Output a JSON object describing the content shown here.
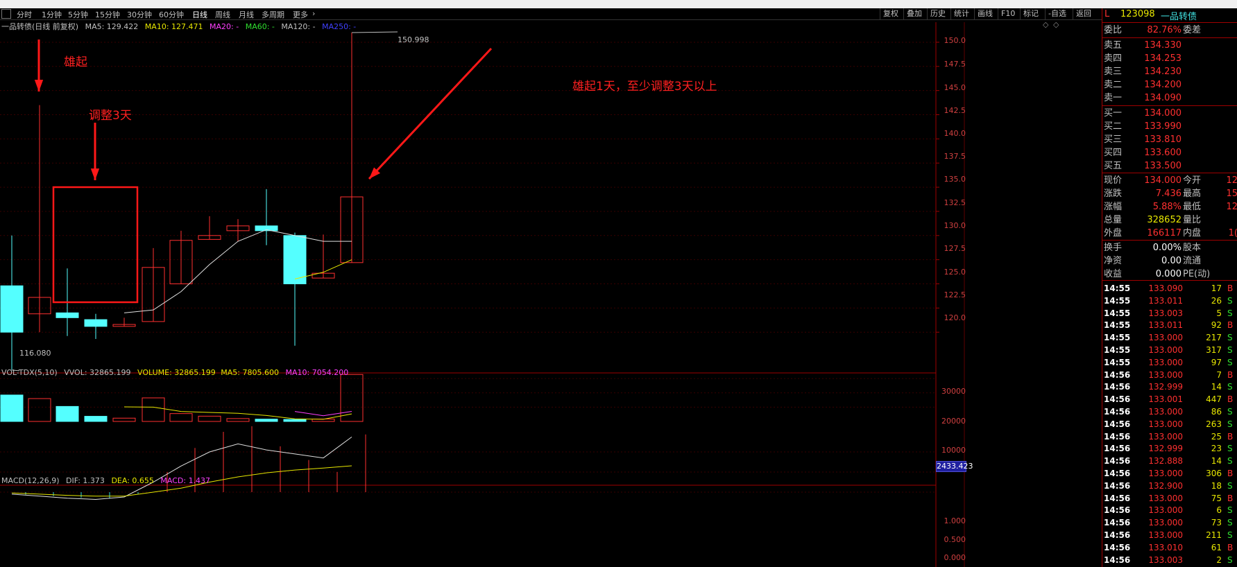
{
  "toolbar": {
    "periods": [
      "分时",
      "1分钟",
      "5分钟",
      "15分钟",
      "30分钟",
      "60分钟",
      "日线",
      "周线",
      "月线",
      "多周期",
      "更多"
    ],
    "active_period": "日线",
    "right_buttons": [
      "复权",
      "叠加",
      "历史",
      "统计",
      "画线",
      "F10",
      "标记",
      "-自选",
      "返回"
    ]
  },
  "chart_info": {
    "title": "一品转债(日线 前复权)",
    "ma5": "MA5: 129.422",
    "ma10": "MA10: 127.471",
    "ma20": "MA20: -",
    "ma60": "MA60: -",
    "ma120": "MA120: -",
    "ma250": "MA250: -",
    "high_label": "150.998",
    "low_label": "116.080"
  },
  "volume_info": {
    "label": "VOL-TDX(5,10)",
    "vvol": "VVOL: 32865.199",
    "volume": "VOLUME: 32865.199",
    "ma5": "MA5: 7805.600",
    "ma10": "MA10: 7054.200",
    "current_box": "2433.423"
  },
  "macd_info": {
    "label": "MACD(12,26,9)",
    "dif": "DIF: 1.373",
    "dea": "DEA: 0.655",
    "macd": "MACD: 1.437"
  },
  "price_axis": [
    "150.0",
    "147.5",
    "145.0",
    "142.5",
    "140.0",
    "137.5",
    "135.0",
    "132.5",
    "130.0",
    "127.5",
    "125.0",
    "122.5",
    "120.0"
  ],
  "vol_axis": [
    "30000",
    "20000",
    "10000"
  ],
  "macd_axis": [
    "1.000",
    "0.500",
    "0.000"
  ],
  "annotations": {
    "a1": "雄起",
    "a2": "调整3天",
    "a3": "雄起1天，至少调整3天以上"
  },
  "quote": {
    "flag": "L",
    "code": "123098",
    "name": "一品转债",
    "weibi_label": "委比",
    "weibi_value": "82.76%",
    "weicha_label": "委差",
    "sell": [
      {
        "label": "卖五",
        "price": "134.330"
      },
      {
        "label": "卖四",
        "price": "134.253"
      },
      {
        "label": "卖三",
        "price": "134.230"
      },
      {
        "label": "卖二",
        "price": "134.200"
      },
      {
        "label": "卖一",
        "price": "134.090"
      }
    ],
    "buy": [
      {
        "label": "买一",
        "price": "134.000"
      },
      {
        "label": "买二",
        "price": "133.990"
      },
      {
        "label": "买三",
        "price": "133.810"
      },
      {
        "label": "买四",
        "price": "133.600"
      },
      {
        "label": "买五",
        "price": "133.500"
      }
    ],
    "stats": [
      {
        "l1": "现价",
        "v1": "134.000",
        "c1": "#ff3030",
        "l2": "今开",
        "v2": "12"
      },
      {
        "l1": "涨跌",
        "v1": "7.436",
        "c1": "#ff3030",
        "l2": "最高",
        "v2": "15"
      },
      {
        "l1": "涨幅",
        "v1": "5.88%",
        "c1": "#ff3030",
        "l2": "最低",
        "v2": "12"
      },
      {
        "l1": "总量",
        "v1": "328652",
        "c1": "#e8e800",
        "l2": "量比",
        "v2": ""
      },
      {
        "l1": "外盘",
        "v1": "166117",
        "c1": "#ff3030",
        "l2": "内盘",
        "v2": "1("
      }
    ],
    "stats2": [
      {
        "l1": "换手",
        "v1": "0.00%",
        "l2": "股本"
      },
      {
        "l1": "净资",
        "v1": "0.00",
        "l2": "流通"
      },
      {
        "l1": "收益",
        "v1": "0.000",
        "l2": "PE(动)"
      }
    ],
    "ticks": [
      {
        "t": "14:55",
        "p": "133.090",
        "v": "17",
        "s": "B"
      },
      {
        "t": "14:55",
        "p": "133.011",
        "v": "26",
        "s": "S"
      },
      {
        "t": "14:55",
        "p": "133.003",
        "v": "5",
        "s": "S"
      },
      {
        "t": "14:55",
        "p": "133.011",
        "v": "92",
        "s": "B"
      },
      {
        "t": "14:55",
        "p": "133.000",
        "v": "217",
        "s": "S"
      },
      {
        "t": "14:55",
        "p": "133.000",
        "v": "317",
        "s": "S"
      },
      {
        "t": "14:55",
        "p": "133.000",
        "v": "97",
        "s": "S"
      },
      {
        "t": "14:56",
        "p": "133.000",
        "v": "7",
        "s": "B"
      },
      {
        "t": "14:56",
        "p": "132.999",
        "v": "14",
        "s": "S"
      },
      {
        "t": "14:56",
        "p": "133.001",
        "v": "447",
        "s": "B"
      },
      {
        "t": "14:56",
        "p": "133.000",
        "v": "86",
        "s": "S"
      },
      {
        "t": "14:56",
        "p": "133.000",
        "v": "263",
        "s": "S"
      },
      {
        "t": "14:56",
        "p": "133.000",
        "v": "25",
        "s": "B"
      },
      {
        "t": "14:56",
        "p": "132.999",
        "v": "23",
        "s": "S"
      },
      {
        "t": "14:56",
        "p": "132.888",
        "v": "14",
        "s": "S"
      },
      {
        "t": "14:56",
        "p": "133.000",
        "v": "306",
        "s": "B"
      },
      {
        "t": "14:56",
        "p": "132.900",
        "v": "18",
        "s": "S"
      },
      {
        "t": "14:56",
        "p": "133.000",
        "v": "75",
        "s": "B"
      },
      {
        "t": "14:56",
        "p": "133.000",
        "v": "6",
        "s": "S"
      },
      {
        "t": "14:56",
        "p": "133.000",
        "v": "73",
        "s": "S"
      },
      {
        "t": "14:56",
        "p": "133.000",
        "v": "211",
        "s": "S"
      },
      {
        "t": "14:56",
        "p": "133.010",
        "v": "61",
        "s": "B"
      },
      {
        "t": "14:56",
        "p": "133.003",
        "v": "2",
        "s": "S"
      }
    ]
  },
  "chart_data": {
    "type": "candlestick",
    "candles": [
      {
        "o": 124.8,
        "c": 120.0,
        "h": 130.0,
        "l": 116.08
      },
      {
        "o": 121.9,
        "c": 123.6,
        "h": 143.5,
        "l": 120.0
      },
      {
        "o": 122.0,
        "c": 121.5,
        "h": 126.6,
        "l": 119.6
      },
      {
        "o": 121.3,
        "c": 120.6,
        "h": 121.9,
        "l": 119.3
      },
      {
        "o": 120.6,
        "c": 120.8,
        "h": 121.5,
        "l": 120.6
      },
      {
        "o": 121.1,
        "c": 126.7,
        "h": 128.7,
        "l": 121.1
      },
      {
        "o": 125.0,
        "c": 129.5,
        "h": 130.5,
        "l": 125.0
      },
      {
        "o": 129.6,
        "c": 130.0,
        "h": 132.0,
        "l": 129.6
      },
      {
        "o": 130.5,
        "c": 131.0,
        "h": 131.7,
        "l": 129.4
      },
      {
        "o": 131.0,
        "c": 130.5,
        "h": 134.8,
        "l": 129.0
      },
      {
        "o": 130.0,
        "c": 125.0,
        "h": 130.3,
        "l": 118.6
      },
      {
        "o": 125.6,
        "c": 126.1,
        "h": 130.1,
        "l": 125.6
      },
      {
        "o": 127.2,
        "c": 134.0,
        "h": 150.998,
        "l": 127.2
      }
    ],
    "ma5": [
      null,
      null,
      null,
      null,
      122.0,
      122.3,
      124.2,
      127.0,
      129.4,
      130.6,
      130.0,
      129.4,
      129.4
    ],
    "ma10": [
      null,
      null,
      null,
      null,
      null,
      null,
      null,
      null,
      null,
      null,
      125.5,
      126.2,
      127.5
    ],
    "volume": [
      18500,
      16000,
      10500,
      3600,
      2300,
      16500,
      5500,
      3700,
      2000,
      1600,
      1400,
      1700,
      32865
    ],
    "vol_ma5": [
      null,
      null,
      null,
      null,
      10200,
      10000,
      7000,
      6300,
      5700,
      4200,
      1800,
      1500,
      5300
    ],
    "vol_ma10": [
      null,
      null,
      null,
      null,
      null,
      null,
      null,
      null,
      null,
      null,
      7000,
      4000,
      7054
    ],
    "macd_dif": [
      -0.05,
      -0.1,
      -0.15,
      -0.18,
      -0.12,
      0.25,
      0.65,
      1.0,
      1.2,
      1.05,
      0.95,
      0.85,
      1.373
    ],
    "macd_dea": [
      -0.02,
      -0.05,
      -0.08,
      -0.1,
      -0.1,
      0.0,
      0.1,
      0.25,
      0.38,
      0.48,
      0.55,
      0.6,
      0.655
    ],
    "price_range": [
      116,
      151
    ],
    "vol_range": [
      0,
      33000
    ],
    "macd_range": [
      0,
      1.45
    ]
  }
}
